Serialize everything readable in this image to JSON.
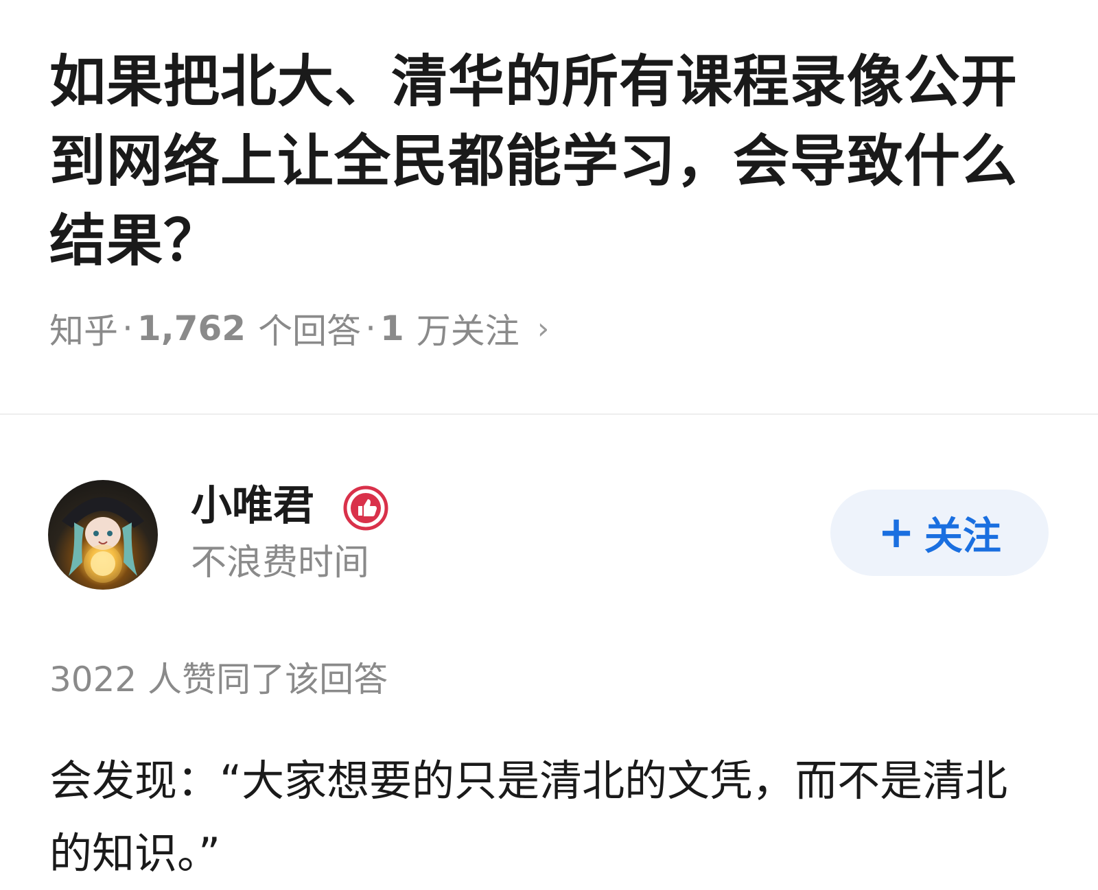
{
  "question": {
    "title": "如果把北大、清华的所有课程录像公开到网络上让全民都能学习，会导致什么结果？",
    "meta": {
      "source": "知乎",
      "separator": "·",
      "answers_count": "1,762",
      "answers_label": "个回答",
      "followers_count": "1",
      "followers_label": "万关注",
      "chevron": "›"
    }
  },
  "author": {
    "name": "小唯君",
    "bio": "不浪费时间",
    "badge_icon": "thumbs-up-badge-icon",
    "badge_color": "#d9314a"
  },
  "follow_button": {
    "plus": "+",
    "label": "关注"
  },
  "answer": {
    "upvotes": "3022 人赞同了该回答",
    "content": "会发现：“大家想要的只是清北的文凭，而不是清北的知识。”"
  },
  "colors": {
    "accent": "#1a6fe0",
    "muted_text": "#8a8a8a",
    "follow_bg": "#eef3fb"
  }
}
